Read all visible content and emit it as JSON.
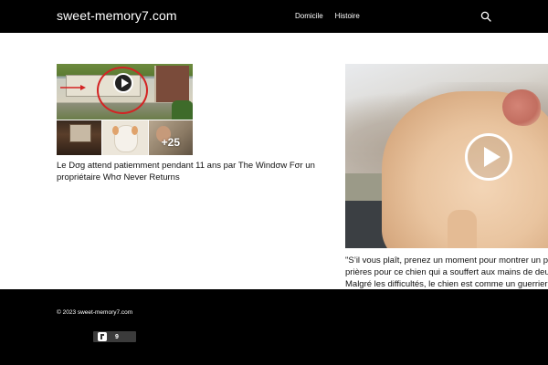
{
  "header": {
    "site_title": "sweet-memory7.com",
    "nav": [
      {
        "label": "Domicile"
      },
      {
        "label": "Histoire"
      }
    ],
    "search_icon": "search-icon"
  },
  "posts": [
    {
      "title": "Le Dσg attend patiemment pendant 11 ans par The Windσw Fσr un propriétaire Whσ Never Returns",
      "media": {
        "type": "video-collage",
        "more_count": "+25",
        "play_icon": "play-icon"
      }
    },
    {
      "excerpt_lines": [
        "\"S’il vous plaît, prenez un moment pour montrer un pe",
        "prières pour ce chien qui a souffert aux mains de deux",
        "Malgré les difficultés, le chien est comme un guerrier"
      ],
      "media": {
        "type": "video",
        "play_icon": "play-icon"
      }
    }
  ],
  "footer": {
    "copyright": "© 2023 sweet-memory7.com",
    "badge_count": "9"
  },
  "colors": {
    "header_bg": "#000000",
    "footer_bg": "#000000",
    "play_outline": "#ffffff",
    "annotation_circle": "#d32323"
  }
}
